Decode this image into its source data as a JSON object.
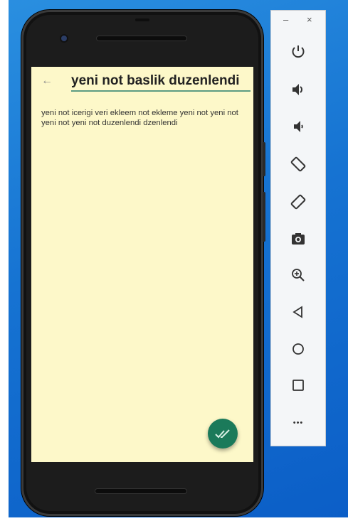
{
  "app": {
    "title": "yeni not baslik duzenlendi",
    "body": "yeni not icerigi veri ekleem not ekleme yeni not yeni not yeni not yeni not duzenlendi dzenlendi"
  },
  "emulator": {
    "minimize_label": "–",
    "close_label": "×",
    "more_label": "•••",
    "tools": [
      "power-icon",
      "volume-up-icon",
      "volume-down-icon",
      "rotate-left-icon",
      "rotate-right-icon",
      "camera-icon",
      "zoom-icon",
      "back-icon",
      "home-icon",
      "overview-icon",
      "more-icon"
    ]
  },
  "colors": {
    "screen_bg": "#fdf8c9",
    "accent": "#1b7a5a",
    "underline": "#5b9b83",
    "desktop": "#1673d2"
  }
}
